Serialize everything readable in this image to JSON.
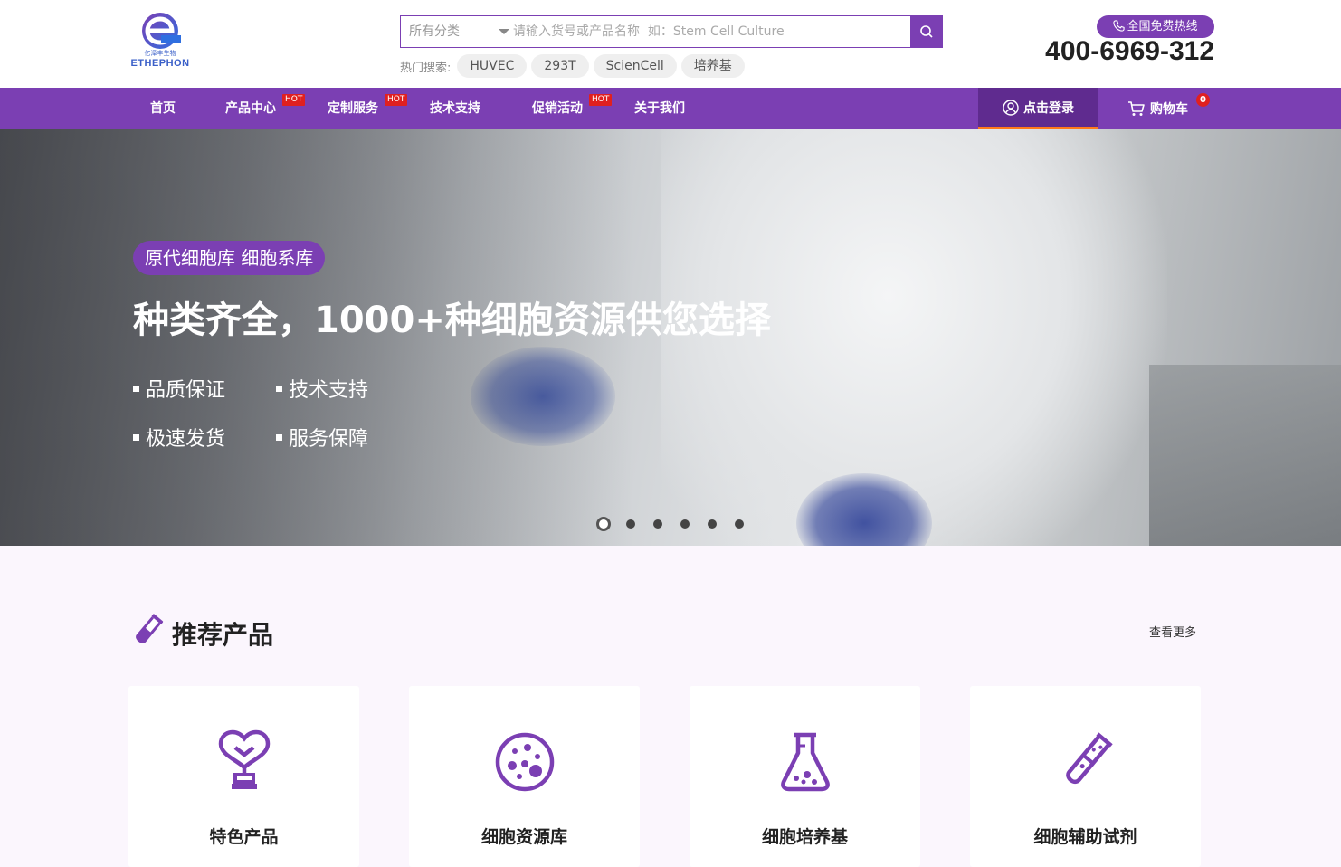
{
  "header": {
    "logo_cn": "亿泽丰生物",
    "logo_en": "ETHEPHON",
    "search": {
      "category": "所有分类",
      "placeholder": "请输入货号或产品名称  如：Stem Cell Culture"
    },
    "hot_label": "热门搜索:",
    "hot_tags": [
      "HUVEC",
      "293T",
      "ScienCell",
      "培养基"
    ],
    "hotline_label": "全国免费热线",
    "phone": "400-6969-312"
  },
  "nav": {
    "items": [
      {
        "label": "首页",
        "hot": ""
      },
      {
        "label": "产品中心",
        "hot": "HOT"
      },
      {
        "label": "定制服务",
        "hot": "HOT"
      },
      {
        "label": "技术支持",
        "hot": ""
      },
      {
        "label": "促销活动",
        "hot": "HOT"
      },
      {
        "label": "关于我们",
        "hot": ""
      }
    ],
    "login": "点击登录",
    "cart": "购物车",
    "cart_count": "0"
  },
  "banner": {
    "tag": "原代细胞库 细胞系库",
    "title": "种类齐全，1000+种细胞资源供您选择",
    "features": [
      "品质保证",
      "技术支持",
      "极速发货",
      "服务保障"
    ],
    "slide_count": 6,
    "active_slide": 1
  },
  "recommended": {
    "title": "推荐产品",
    "more": "查看更多",
    "cards": [
      {
        "label": "特色产品",
        "icon": "heart-trophy-icon"
      },
      {
        "label": "细胞资源库",
        "icon": "petri-dish-icon"
      },
      {
        "label": "细胞培养基",
        "icon": "flask-icon"
      },
      {
        "label": "细胞辅助试剂",
        "icon": "test-tube-icon"
      }
    ]
  },
  "colors": {
    "brand": "#7b3fb3",
    "login_bg": "#5f2b8f",
    "accent": "#ff7a1a",
    "hot": "#e02020"
  }
}
